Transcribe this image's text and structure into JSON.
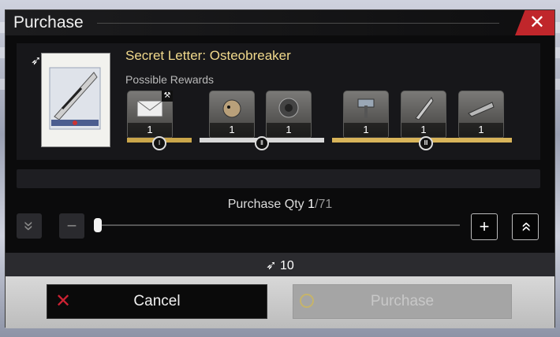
{
  "dialog": {
    "title": "Purchase",
    "close_label": "✕"
  },
  "item": {
    "name": "Secret Letter: Osteobreaker",
    "rewards_label": "Possible Rewards",
    "rewards": [
      {
        "qty": "1",
        "icon": "letter-icon",
        "tier": "I"
      },
      {
        "qty": "1",
        "icon": "mask-icon",
        "tier": "II"
      },
      {
        "qty": "1",
        "icon": "sphere-icon",
        "tier": "II"
      },
      {
        "qty": "1",
        "icon": "hammer-icon",
        "tier": "III"
      },
      {
        "qty": "1",
        "icon": "spear-icon",
        "tier": "III"
      },
      {
        "qty": "1",
        "icon": "blade-icon",
        "tier": "III"
      }
    ],
    "tiers": [
      "Ⅰ",
      "Ⅱ",
      "Ⅲ"
    ]
  },
  "quantity": {
    "label": "Purchase Qty ",
    "current": "1",
    "max": "/71",
    "fraction": 0.014
  },
  "controls": {
    "min_label": "»",
    "minus_label": "−",
    "plus_label": "+",
    "max_label": "»"
  },
  "cost": {
    "value": "10"
  },
  "buttons": {
    "cancel_label": "Cancel",
    "purchase_label": "Purchase"
  },
  "colors": {
    "accent_gold": "#f1d98c",
    "close_red": "#c0262b"
  }
}
